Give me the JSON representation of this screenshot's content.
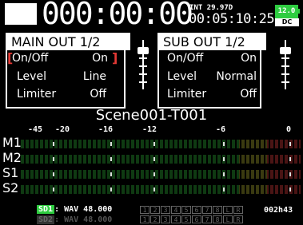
{
  "status": {
    "timecode": "000:00:00",
    "fs": "INT 29.97D",
    "abs_time": "00:05:10:25",
    "battery": "12.0",
    "power": "DC"
  },
  "main_out": {
    "title": "MAIN OUT 1/2",
    "rows": [
      {
        "label": "On/Off",
        "value": "On"
      },
      {
        "label": "Level",
        "value": "Line"
      },
      {
        "label": "Limiter",
        "value": "Off"
      }
    ]
  },
  "sub_out": {
    "title": "SUB OUT 1/2",
    "rows": [
      {
        "label": "On/Off",
        "value": "On"
      },
      {
        "label": "Level",
        "value": "Normal"
      },
      {
        "label": "Limiter",
        "value": "Off"
      }
    ]
  },
  "scene": "Scene001-T001",
  "meter_scale": [
    "-45",
    "-20",
    "-16",
    "-12",
    "-6",
    "0"
  ],
  "channels": [
    "M1",
    "M2",
    "S1",
    "S2"
  ],
  "media": [
    {
      "tag": "SD1",
      "info": ": WAV 48.000"
    },
    {
      "tag": "SD2",
      "info": ": WAV 48.000"
    }
  ],
  "tracks": [
    "1",
    "2",
    "3",
    "4",
    "5",
    "6",
    "7",
    "8",
    "L",
    "R"
  ],
  "remaining": "002h43",
  "colors": {
    "ok_green": "#2ecc40",
    "selector_red": "#e53935"
  }
}
